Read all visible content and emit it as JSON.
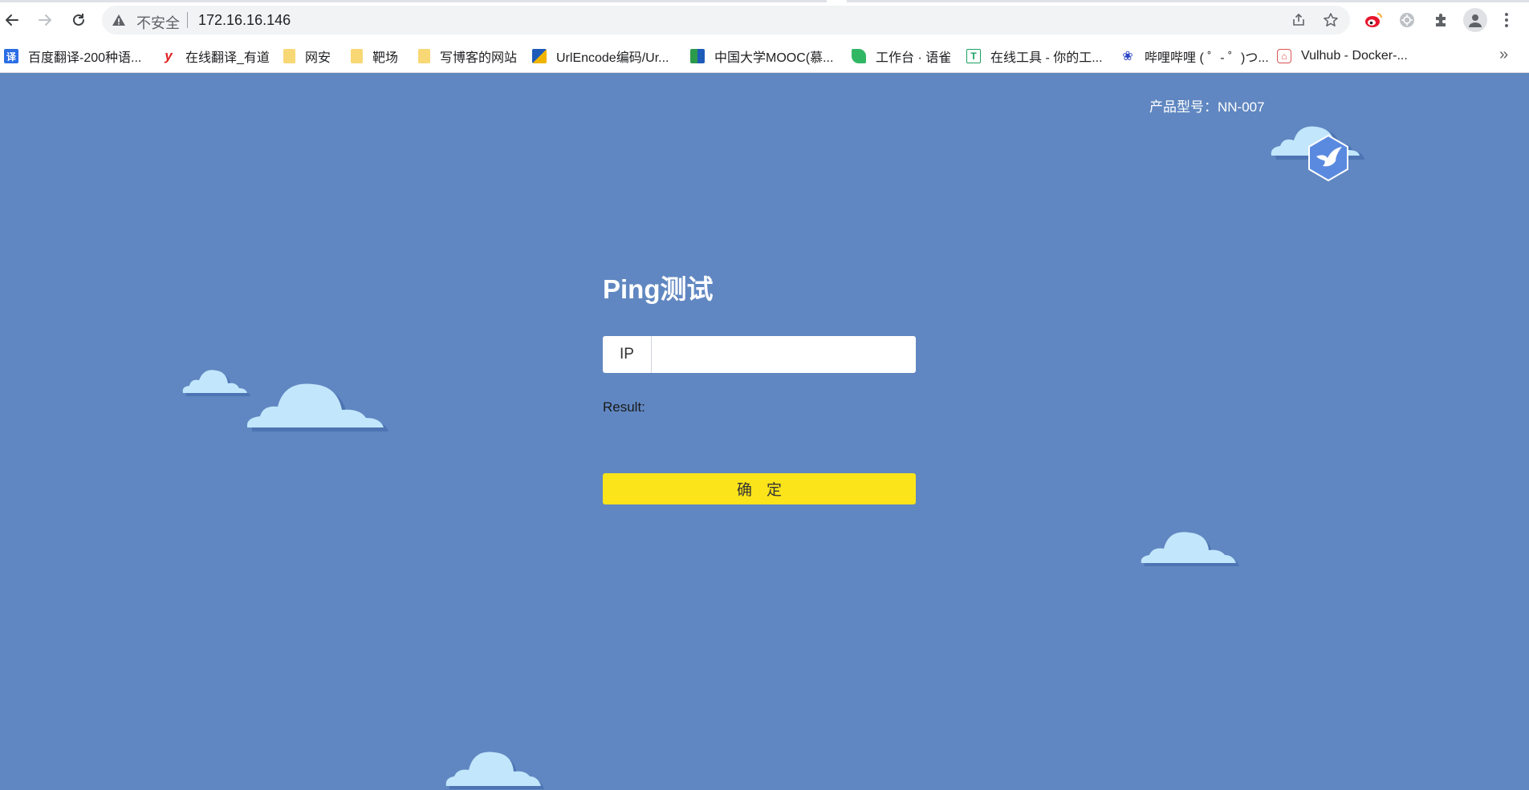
{
  "browser": {
    "security_label": "不安全",
    "url": "172.16.16.146",
    "bookmarks": [
      {
        "label": "百度翻译-200种语...",
        "icon": "baidu-translate-icon",
        "color": "#2b6de5"
      },
      {
        "label": "在线翻译_有道",
        "icon": "youdao-icon",
        "color": "#e02020"
      },
      {
        "label": "网安",
        "icon": "folder-icon",
        "color": "#f5c842"
      },
      {
        "label": "靶场",
        "icon": "folder-icon",
        "color": "#f5c842"
      },
      {
        "label": "写博客的网站",
        "icon": "folder-icon",
        "color": "#f5c842"
      },
      {
        "label": "UrlEncode编码/Ur...",
        "icon": "urlencode-icon",
        "color": "#1e5ab8"
      },
      {
        "label": "中国大学MOOC(慕...",
        "icon": "mooc-icon",
        "color": "#2b9a4b"
      },
      {
        "label": "工作台 · 语雀",
        "icon": "yuque-icon",
        "color": "#31b764"
      },
      {
        "label": "在线工具 - 你的工...",
        "icon": "tool-icon",
        "color": "#1aa260"
      },
      {
        "label": "哔哩哔哩 ( ゜- ゜)つ...",
        "icon": "bilibili-icon",
        "color": "#2b45c8"
      },
      {
        "label": "Vulhub - Docker-...",
        "icon": "vulhub-icon",
        "color": "#d9534f"
      }
    ],
    "more_label": "»"
  },
  "page": {
    "model_label": "产品型号：NN-007",
    "title": "Ping测试",
    "ip_label": "IP",
    "ip_value": "",
    "result_label": "Result:",
    "submit_label": "确定"
  },
  "colors": {
    "background": "#6087c1",
    "button": "#fbe41a",
    "cloud": "#c2e6fb",
    "cloud_shadow": "#4d74b3"
  }
}
